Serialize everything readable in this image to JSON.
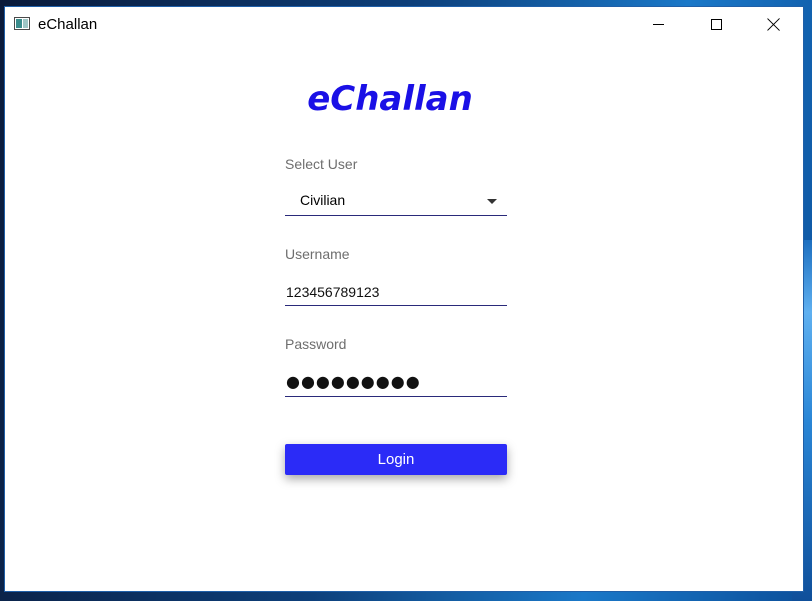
{
  "window": {
    "title": "eChallan"
  },
  "app": {
    "heading": "eChallan",
    "accent_color": "#1a10e6",
    "button_color": "#2b2bf7"
  },
  "form": {
    "select_user_label": "Select User",
    "select_user_value": "Civilian",
    "username_label": "Username",
    "username_value": "123456789123",
    "password_label": "Password",
    "password_masked": "●●●●●●●●●",
    "login_label": "Login"
  },
  "icons": {
    "app": "app-window-icon",
    "minimize": "minimize-icon",
    "maximize": "maximize-icon",
    "close": "close-icon",
    "dropdown": "chevron-down-icon"
  }
}
